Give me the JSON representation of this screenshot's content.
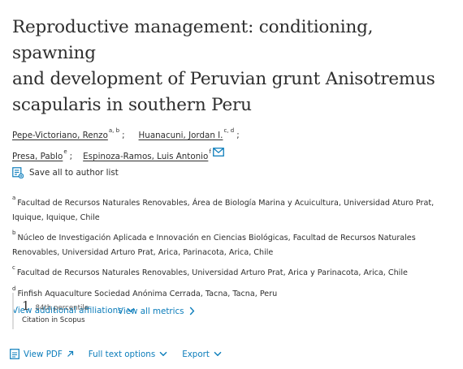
{
  "article": {
    "title_lines": [
      "Reproductive management: conditioning, spawning",
      "and development of Peruvian grunt Anisotremus",
      "scapularis in southern Peru"
    ]
  },
  "authors": [
    {
      "name": "Pepe-Victoriano, Renzo",
      "sup": "a, b",
      "sep": ";"
    },
    {
      "name": "Huanacuni, Jordan I.",
      "sup": "c, d",
      "sep": ";"
    },
    {
      "name": "Presa, Pablo",
      "sup": "e",
      "sep": ";"
    },
    {
      "name": "Espinoza-Ramos, Luis Antonio",
      "sup": "f",
      "sep": ""
    }
  ],
  "save_label": "Save all to author list",
  "affiliations": [
    {
      "sup": "a",
      "text": "Facultad de Recursos Naturales Renovables, Área de Biología Marina y Acuicultura, Universidad Aturo Prat, Iquique, Iquique, Chile"
    },
    {
      "sup": "b",
      "text": "Núcleo de Investigación Aplicada e Innovación en Ciencias Biológicas, Facultad de Recursos Naturales Renovables, Universidad Arturo Prat, Arica, Parinacota, Arica, Chile"
    },
    {
      "sup": "c",
      "text": "Facultad de Recursos Naturales Renovables, Universidad Arturo Prat, Arica y Parinacota, Arica, Chile"
    },
    {
      "sup": "d",
      "text": "Finfish Aquaculture Sociedad Anónima Cerrada, Tacna, Tacna, Peru"
    }
  ],
  "view_affiliations_label": "View additional affiliations",
  "metrics": {
    "count": "1",
    "percentile": "84th percentile",
    "label": "Citation in Scopus",
    "view_all": "View all metrics"
  },
  "toolbar": {
    "view_pdf": "View PDF",
    "full_text": "Full text options",
    "export": "Export"
  },
  "colors": {
    "link": "#0c7dbb",
    "text": "#2e2e2e",
    "metric_bar": "#dcdcdc"
  },
  "icons": [
    "envelope-icon",
    "save-list-icon",
    "chevron-down-icon",
    "chevron-right-icon",
    "pdf-icon",
    "external-arrow-icon"
  ]
}
